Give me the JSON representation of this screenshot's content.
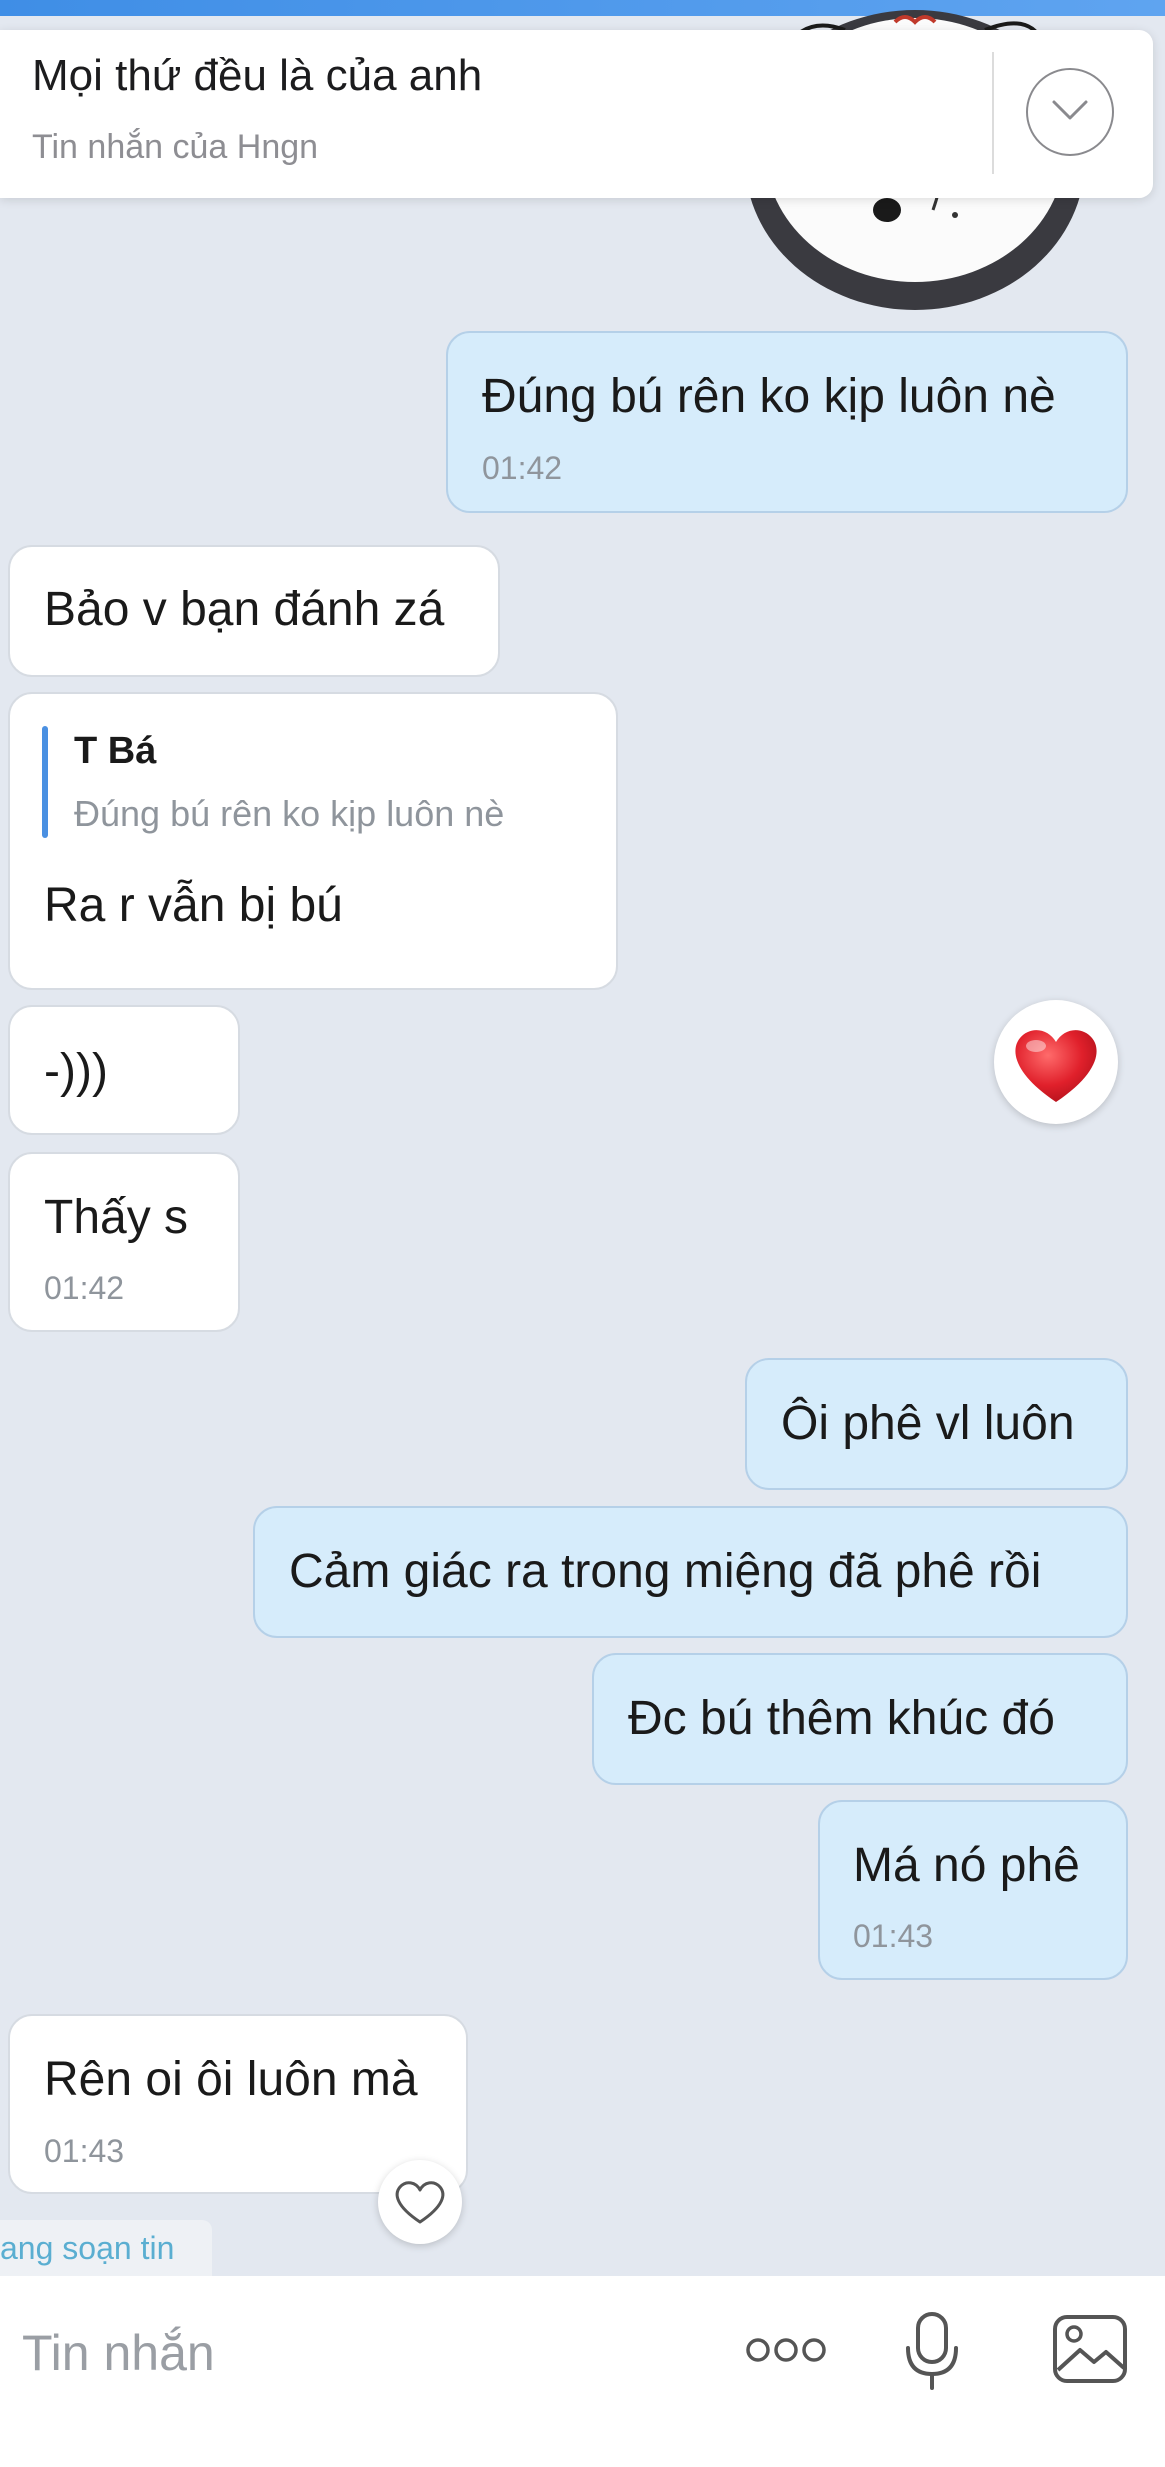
{
  "notification": {
    "title": "Mọi thứ đều là của anh",
    "subtitle": "Tin nhắn của Hngn"
  },
  "messages": [
    {
      "side": "out",
      "text": "Đúng bú rên ko kịp luôn nè",
      "time": "01:42"
    },
    {
      "side": "in",
      "text": "Bảo v bạn đánh zá"
    },
    {
      "side": "in",
      "quote_name": "T Bá",
      "quote_text": "Đúng bú rên ko kịp luôn nè",
      "text": "Ra r vẫn bị bú"
    },
    {
      "side": "in",
      "text": "-)))",
      "reaction": "heart"
    },
    {
      "side": "in",
      "text": "Thấy s",
      "time": "01:42"
    },
    {
      "side": "out",
      "text": "Ôi phê vl luôn"
    },
    {
      "side": "out",
      "text": "Cảm giác ra trong miệng đã phê rồi"
    },
    {
      "side": "out",
      "text": "Đc bú thêm khúc đó"
    },
    {
      "side": "out",
      "text": "Má nó phê",
      "time": "01:43"
    },
    {
      "side": "in",
      "text": "Rên oi ôi luôn mà",
      "time": "01:43"
    }
  ],
  "typing_indicator": "ang soạn tin",
  "composer": {
    "placeholder": "Tin nhắn"
  },
  "icons": [
    "chevron-down-icon",
    "heart-icon",
    "heart-outline-icon",
    "more-icon",
    "microphone-icon",
    "image-icon"
  ],
  "colors": {
    "background": "#e3e8f0",
    "outgoing_bubble": "#d6ecfb",
    "incoming_bubble": "#ffffff",
    "quote_bar": "#4a90e2",
    "typing_text": "#5aaed1",
    "reaction_heart": "#e0202b"
  }
}
